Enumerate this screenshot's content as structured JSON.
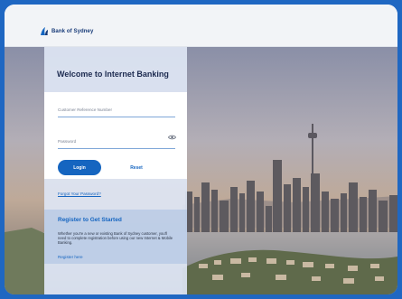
{
  "brand": {
    "name": "Bank of Sydney",
    "color": "#173a78",
    "icon": "sail-logo-icon"
  },
  "colors": {
    "accent": "#1565c0",
    "outer_border": "#1f67c2"
  },
  "login": {
    "title": "Welcome to Internet Banking",
    "crn_placeholder": "Customer Reference Number",
    "password_placeholder": "Password",
    "password_toggle_icon": "eye-icon",
    "login_label": "Login",
    "reset_label": "Reset",
    "forgot_label": "Forgot Your Password?"
  },
  "register": {
    "title": "Register to Get Started",
    "description": "Whether you're a new or existing Bank of Sydney customer, you'll need to complete registration before using our new Internet & Mobile Banking.",
    "link_label": "Register here"
  }
}
